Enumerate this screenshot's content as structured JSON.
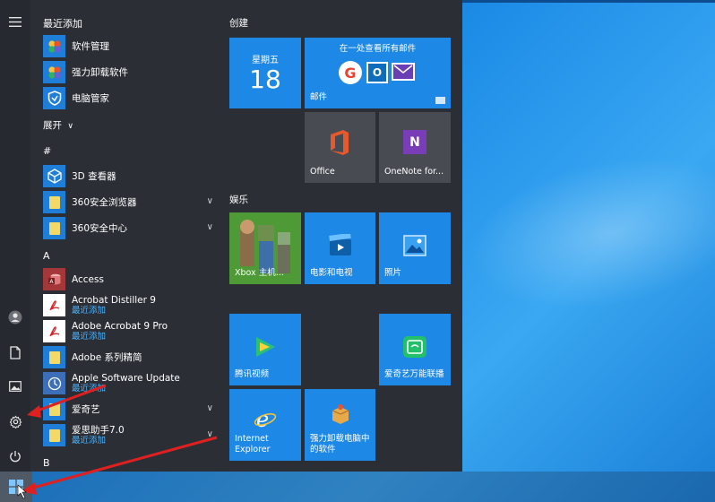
{
  "recent": {
    "header": "最近添加",
    "items": [
      {
        "label": "软件管理"
      },
      {
        "label": "强力卸载软件"
      },
      {
        "label": "电脑管家"
      }
    ],
    "expand": "展开"
  },
  "sections": {
    "hash": "#",
    "a": "A",
    "b": "B"
  },
  "apps_hash": [
    {
      "label": "3D 查看器"
    },
    {
      "label": "360安全浏览器"
    },
    {
      "label": "360安全中心"
    }
  ],
  "apps_a": [
    {
      "label": "Access",
      "sub": ""
    },
    {
      "label": "Acrobat Distiller 9",
      "sub": "最近添加"
    },
    {
      "label": "Adobe Acrobat 9 Pro",
      "sub": "最近添加"
    },
    {
      "label": "Adobe 系列精简",
      "sub": ""
    },
    {
      "label": "Apple Software Update",
      "sub": "最近添加"
    },
    {
      "label": "爱奇艺",
      "sub": ""
    },
    {
      "label": "爱思助手7.0",
      "sub": "最近添加"
    }
  ],
  "groups": {
    "create": "创建",
    "entertainment": "娱乐"
  },
  "tiles": {
    "calendar_day": "星期五",
    "calendar_date": "18",
    "mail_title": "在一处查看所有邮件",
    "mail_label": "邮件",
    "office": "Office",
    "onenote": "OneNote for...",
    "xbox": "Xbox 主机...",
    "movies": "电影和电视",
    "photos": "照片",
    "tencent_video": "腾讯视频",
    "iqiyi_cast": "爱奇艺万能联播",
    "ie": "Internet Explorer",
    "uninstaller": "强力卸载电脑中的软件"
  },
  "colors": {
    "tile_blue": "#1e88e6",
    "menu_bg": "#2b2f35",
    "accent_link": "#4cb3ff",
    "annotation_arrow": "#e02020"
  },
  "icons": [
    "hamburger-menu-icon",
    "user-icon",
    "document-icon",
    "pictures-icon",
    "settings-gear-icon",
    "power-icon",
    "windows-start-icon"
  ]
}
